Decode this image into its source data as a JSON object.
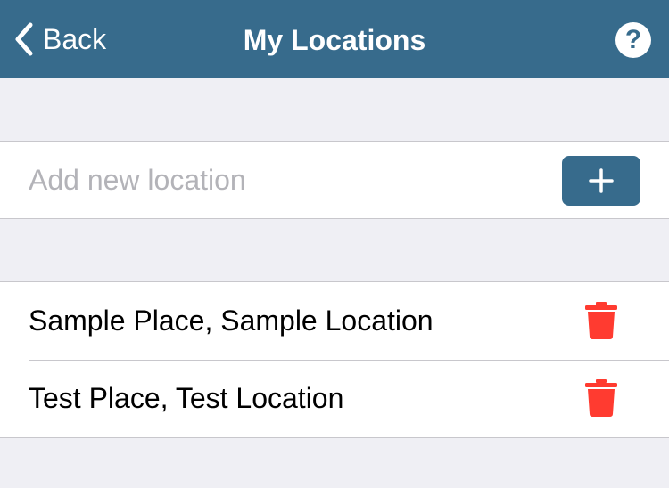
{
  "nav": {
    "back_label": "Back",
    "title": "My Locations",
    "help_label": "?"
  },
  "add_location": {
    "placeholder": "Add new location",
    "value": ""
  },
  "locations": [
    {
      "label": "Sample Place, Sample Location"
    },
    {
      "label": "Test Place, Test Location"
    }
  ],
  "colors": {
    "nav_background": "#376b8c",
    "accent": "#376b8c",
    "delete": "#ff3b30",
    "background": "#efeff4"
  }
}
